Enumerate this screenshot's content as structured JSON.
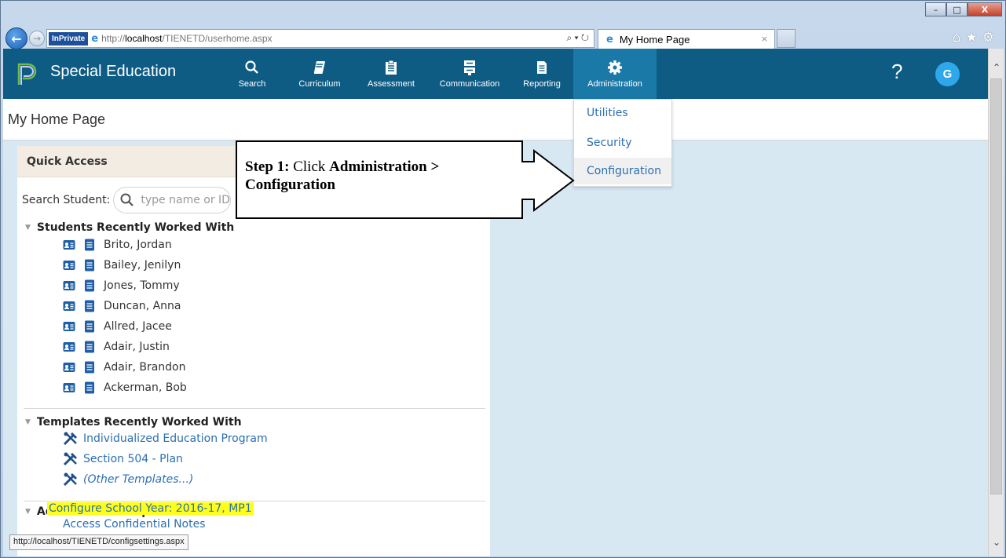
{
  "browser": {
    "inprivate": "InPrivate",
    "url_prefix": "http://",
    "url_host": "localhost",
    "url_path": "/TIENETD/userhome.aspx",
    "addr_tools": "⌕ ▾ ↻",
    "tab_title": "My Home Page",
    "tab_close": "×",
    "tools": "⌂★⚙",
    "window_minimize": "–",
    "window_maximize": "□",
    "window_close": "X",
    "status_url": "http://localhost/TIENETD/configsettings.aspx"
  },
  "app": {
    "title": "Special Education",
    "nav": [
      {
        "label": "Search",
        "icon": "search-icon"
      },
      {
        "label": "Curriculum",
        "icon": "book-icon"
      },
      {
        "label": "Assessment",
        "icon": "clipboard-icon"
      },
      {
        "label": "Communication",
        "icon": "server-icon"
      },
      {
        "label": "Reporting",
        "icon": "report-icon"
      },
      {
        "label": "Administration",
        "icon": "gear-icon"
      }
    ],
    "help": "?",
    "avatar": "G",
    "accent": "#0e5c84",
    "active_nav": "#1b79a8",
    "link_color": "#2a6fb1"
  },
  "page": {
    "title": "My Home Page"
  },
  "admin_menu": {
    "items": [
      "Utilities",
      "Security",
      "Configuration"
    ],
    "hovered": "Configuration"
  },
  "quick_access": {
    "title": "Quick Access",
    "search_label": "Search Student:",
    "search_placeholder": "type name or ID",
    "students_head": "Students Recently Worked With",
    "students": [
      "Brito, Jordan",
      "Bailey, Jenilyn",
      "Jones, Tommy",
      "Duncan, Anna",
      "Allred, Jacee",
      "Adair, Justin",
      "Adair, Brandon",
      "Ackerman, Bob"
    ],
    "templates_head": "Templates Recently Worked With",
    "templates": [
      "Individualized Education Program",
      "Section 504 - Plan",
      "(Other Templates...)"
    ],
    "admin_head": "Administrative Options",
    "admin_link": "Configure School Year: 2016-17, MP1",
    "admin_link2": "Access Confidential Notes"
  },
  "callout": {
    "step": "Step 1:",
    "text1": "Click",
    "bold1": "Administration >",
    "bold2": "Configuration"
  }
}
